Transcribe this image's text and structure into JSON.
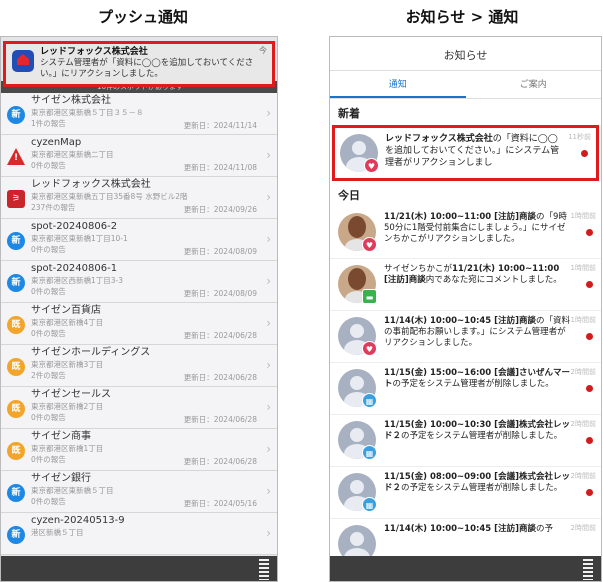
{
  "titles": {
    "left": "プッシュ通知",
    "right": "お知らせ > 通知"
  },
  "left": {
    "notification": {
      "app": "レッドフォックス株式会社",
      "body": "システム管理者が「資料に◯◯を追加しておいてください。」にリアクションしました。",
      "more": "今"
    },
    "banner": "16件のスポットがあります",
    "items": [
      {
        "icon": "新",
        "name": "サイゼン株式会社",
        "addr": "東京都港区東新橋５丁目３５－８",
        "count": "1件の報告",
        "updated": "更新日：2024/11/14"
      },
      {
        "icon": "!",
        "name": "cyzenMap",
        "addr": "東京都港区東新橋二丁目",
        "count": "0件の報告",
        "updated": "更新日：2024/11/08"
      },
      {
        "icon": "⚞",
        "name": "レッドフォックス株式会社",
        "addr": "東京都港区東新橋五丁目35番8号 水野ビル2階",
        "count": "237件の報告",
        "updated": "更新日：2024/09/26"
      },
      {
        "icon": "新",
        "name": "spot-20240806-2",
        "addr": "東京都港区東新橋1丁目10-1",
        "count": "0件の報告",
        "updated": "更新日：2024/08/09"
      },
      {
        "icon": "新",
        "name": "spot-20240806-1",
        "addr": "東京都港区西新橋1丁目3-3",
        "count": "0件の報告",
        "updated": "更新日：2024/08/09"
      },
      {
        "icon": "既",
        "name": "サイゼン百貨店",
        "addr": "東京都港区新橋4丁目",
        "count": "0件の報告",
        "updated": "更新日：2024/06/28"
      },
      {
        "icon": "既",
        "name": "サイゼンホールディングス",
        "addr": "東京都港区新橋3丁目",
        "count": "2件の報告",
        "updated": "更新日：2024/06/28"
      },
      {
        "icon": "既",
        "name": "サイゼンセールス",
        "addr": "東京都港区新橋2丁目",
        "count": "0件の報告",
        "updated": "更新日：2024/06/28"
      },
      {
        "icon": "既",
        "name": "サイゼン商事",
        "addr": "東京都港区新橋1丁目",
        "count": "0件の報告",
        "updated": "更新日：2024/06/28"
      },
      {
        "icon": "新",
        "name": "サイゼン銀行",
        "addr": "東京都港区東新橋５丁目",
        "count": "0件の報告",
        "updated": "更新日：2024/05/16"
      },
      {
        "icon": "新",
        "name": "cyzen-20240513-9",
        "addr": "港区新橋５丁目",
        "count": "",
        "updated": ""
      }
    ]
  },
  "right": {
    "header": "お知らせ",
    "tabs": [
      "通知",
      "ご案内"
    ],
    "new_label": "新着",
    "today_label": "今日",
    "highlight": {
      "bold": "レッドフォックス株式会社",
      "rest": "の「資料に◯◯を追加しておいてください。」にシステム管理者がリアクションしまし",
      "time": "11秒前"
    },
    "items": [
      {
        "pre": "",
        "bold": "11/21(木) 10:00~11:00 [注訪]商談",
        "rest": "の「9時50分に1階受付前集合にしましょう。」にサイゼンちかこがリアクションしました。",
        "time": "1時間前"
      },
      {
        "pre": "サイゼンちかこが",
        "bold": "11/21(木) 10:00~11:00 [注訪]商談",
        "rest": "内であなた宛にコメントしました。",
        "time": "1時間前"
      },
      {
        "pre": "",
        "bold": "11/14(木) 10:00~10:45 [注訪]商談",
        "rest": "の「資料の事前配布お願いします。」にシステム管理者がリアクションしました。",
        "time": "1時間前"
      },
      {
        "pre": "",
        "bold": "11/15(金) 15:00~16:00 [会議]さいぜんマート",
        "rest": "の予定をシステム管理者が削除しました。",
        "time": "2時間前"
      },
      {
        "pre": "",
        "bold": "11/15(金) 10:00~10:30 [会議]株式会社レッド２",
        "rest": "の予定をシステム管理者が削除しました。",
        "time": "2時間前"
      },
      {
        "pre": "",
        "bold": "11/15(金) 08:00~09:00 [会議]株式会社レッド２",
        "rest": "の予定をシステム管理者が削除しました。",
        "time": "2時間前"
      },
      {
        "pre": "",
        "bold": "11/14(木) 10:00~10:45 [注訪]商談",
        "rest": "の予",
        "time": "2時間前"
      }
    ]
  }
}
